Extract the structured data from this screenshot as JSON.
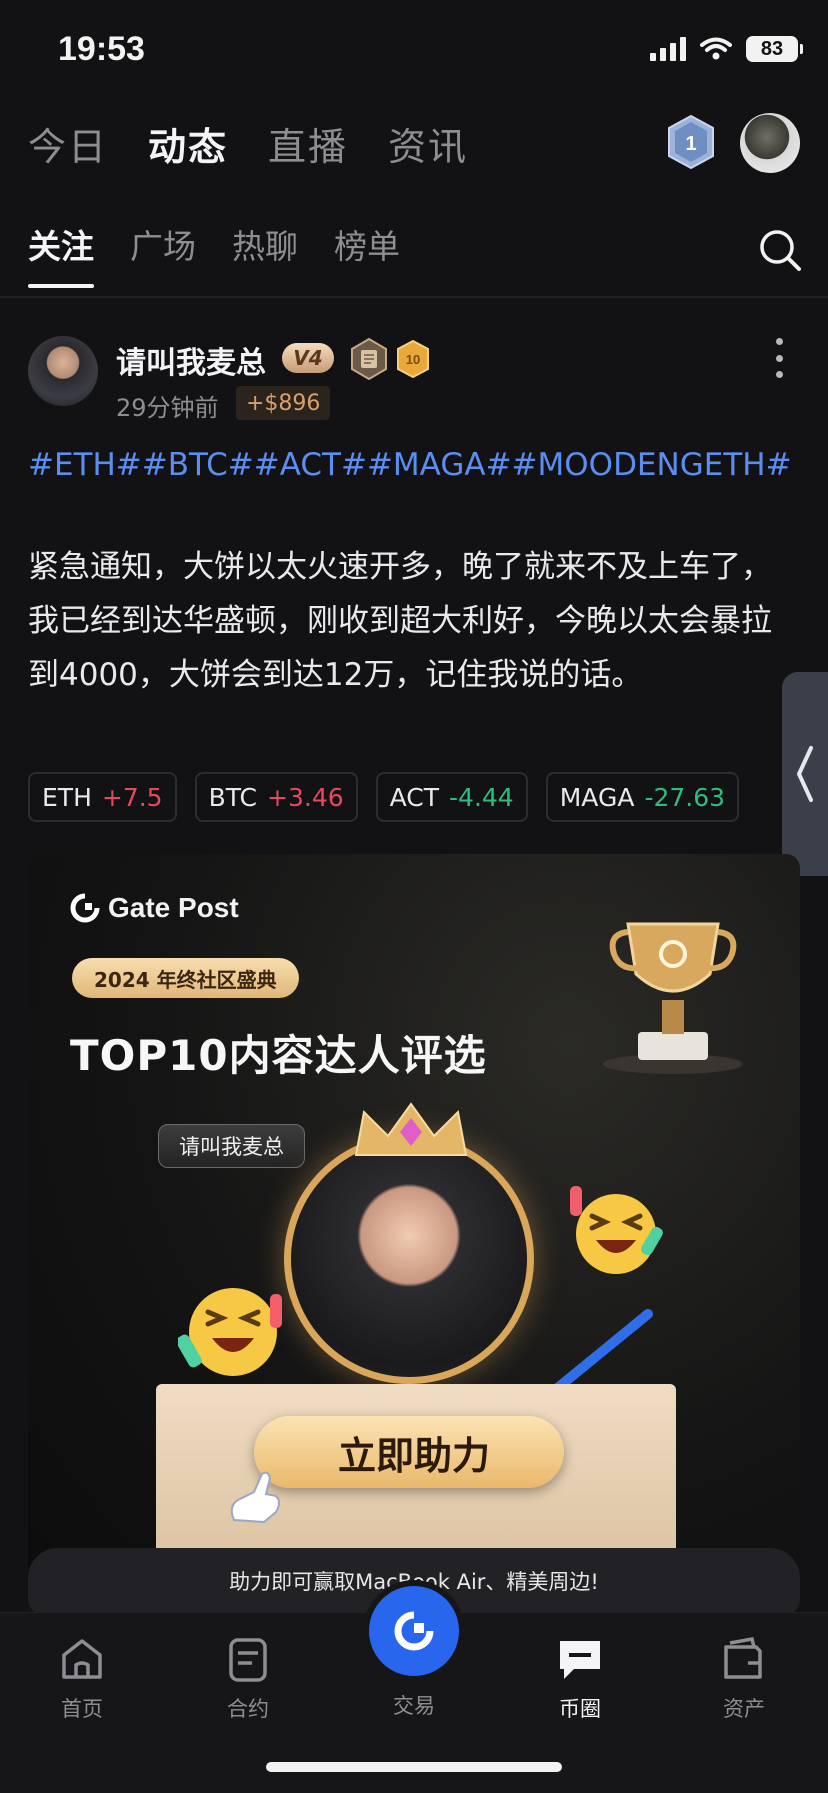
{
  "status_bar": {
    "time": "19:53",
    "battery": "83"
  },
  "top_nav": {
    "tabs": [
      {
        "label": "今日",
        "active": false
      },
      {
        "label": "动态",
        "active": true
      },
      {
        "label": "直播",
        "active": false
      },
      {
        "label": "资讯",
        "active": false
      }
    ],
    "rank_badge": "1"
  },
  "sub_nav": {
    "tabs": [
      {
        "label": "关注",
        "active": true
      },
      {
        "label": "广场",
        "active": false
      },
      {
        "label": "热聊",
        "active": false
      },
      {
        "label": "榜单",
        "active": false
      }
    ]
  },
  "post": {
    "author": "请叫我麦总",
    "vip_level": "V4",
    "medal_level": "10",
    "time_ago": "29分钟前",
    "profit": "+$896",
    "hashtags": "#ETH##BTC##ACT##MAGA##MOODENGETH#",
    "content": "紧急通知，大饼以太火速开多，晚了就来不及上车了，我已经到达华盛顿，刚收到超大利好，今晚以太会暴拉到4000，大饼会到达12万，记住我说的话。",
    "tickers": [
      {
        "symbol": "ETH",
        "change": "+7.5",
        "direction": "up"
      },
      {
        "symbol": "BTC",
        "change": "+3.46",
        "direction": "up"
      },
      {
        "symbol": "ACT",
        "change": "-4.44",
        "direction": "down"
      },
      {
        "symbol": "MAGA",
        "change": "-27.63",
        "direction": "down"
      }
    ]
  },
  "promo": {
    "brand": "Gate Post",
    "pill": "2024 年终社区盛典",
    "title": "TOP10内容达人评选",
    "name_bubble": "请叫我麦总",
    "cta": "立即助力",
    "footer": "助力即可赢取MacBook Air、精美周边!"
  },
  "bottom_nav": {
    "items": [
      {
        "label": "首页",
        "icon": "home-icon"
      },
      {
        "label": "合约",
        "icon": "contract-icon"
      },
      {
        "label": "交易",
        "icon": "trade-icon"
      },
      {
        "label": "币圈",
        "icon": "chat-icon",
        "active": true
      },
      {
        "label": "资产",
        "icon": "wallet-icon"
      }
    ]
  },
  "colors": {
    "accent": "#2866ee",
    "up": "#e5495b",
    "down": "#2fbd7e",
    "link": "#5a8ef0"
  }
}
